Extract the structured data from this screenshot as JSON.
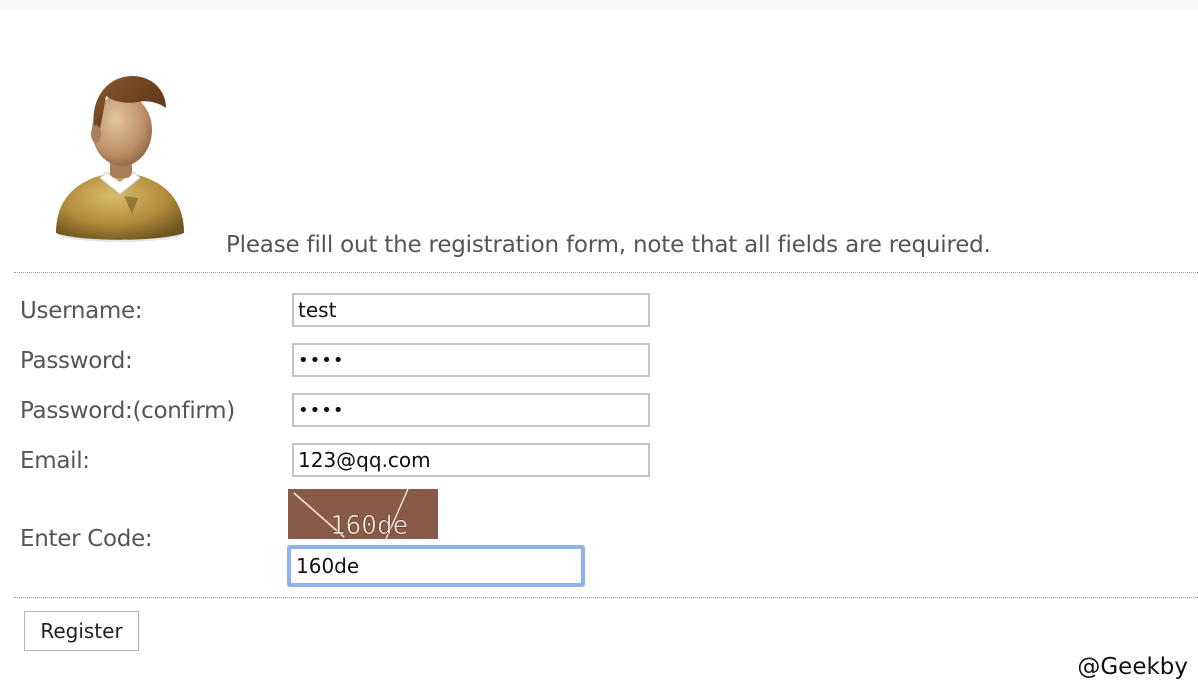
{
  "header": {
    "intro": "Please fill out the registration form, note that all fields are required."
  },
  "form": {
    "username": {
      "label": "Username:",
      "value": "test"
    },
    "password": {
      "label": "Password:",
      "value": "test"
    },
    "password_confirm": {
      "label": "Password:(confirm)",
      "value": "test"
    },
    "email": {
      "label": "Email:",
      "value": "123@qq.com"
    },
    "code": {
      "label": "Enter Code:",
      "captcha_text": "160de",
      "value": "160de"
    },
    "submit_label": "Register"
  },
  "watermark": "@Geekby",
  "colors": {
    "text": "#555555",
    "captcha_bg": "#8a5a48",
    "focus_ring": "#8fb1ee",
    "field_border": "#c4c4c4"
  },
  "icons": {
    "avatar": "user-avatar-icon"
  }
}
